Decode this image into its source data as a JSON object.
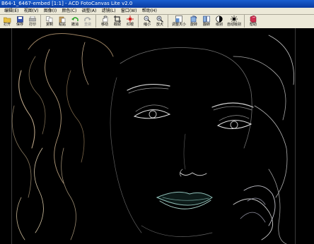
{
  "window": {
    "title": "B64-1_6467-embed [1:1] - ACD FotoCanvas Lite v2.0"
  },
  "menu": [
    "编辑(E)",
    "视图(V)",
    "图像(I)",
    "颜色(C)",
    "调整(A)",
    "滤镜(L)",
    "窗口(W)",
    "帮助(H)"
  ],
  "toolbar": [
    {
      "label": "打开",
      "icon": "open-folder-icon"
    },
    {
      "label": "保存",
      "icon": "save-icon"
    },
    {
      "label": "打印",
      "icon": "print-icon"
    },
    {
      "label": "复制",
      "icon": "copy-icon"
    },
    {
      "label": "粘贴",
      "icon": "paste-icon"
    },
    {
      "label": "撤消",
      "icon": "undo-icon"
    },
    {
      "label": "重做",
      "icon": "redo-icon"
    },
    {
      "label": "移动",
      "icon": "hand-move-icon"
    },
    {
      "label": "截取",
      "icon": "crop-icon"
    },
    {
      "label": "红眼",
      "icon": "red-eye-icon"
    },
    {
      "label": "缩小",
      "icon": "zoom-out-icon"
    },
    {
      "label": "放大",
      "icon": "zoom-in-icon"
    },
    {
      "label": "调整大小",
      "icon": "resize-icon"
    },
    {
      "label": "旋转",
      "icon": "rotate-icon"
    },
    {
      "label": "翻转",
      "icon": "flip-icon"
    },
    {
      "label": "级别",
      "icon": "levels-icon"
    },
    {
      "label": "自动级别",
      "icon": "auto-levels-icon"
    },
    {
      "label": "帮助",
      "icon": "help-book-icon"
    }
  ]
}
